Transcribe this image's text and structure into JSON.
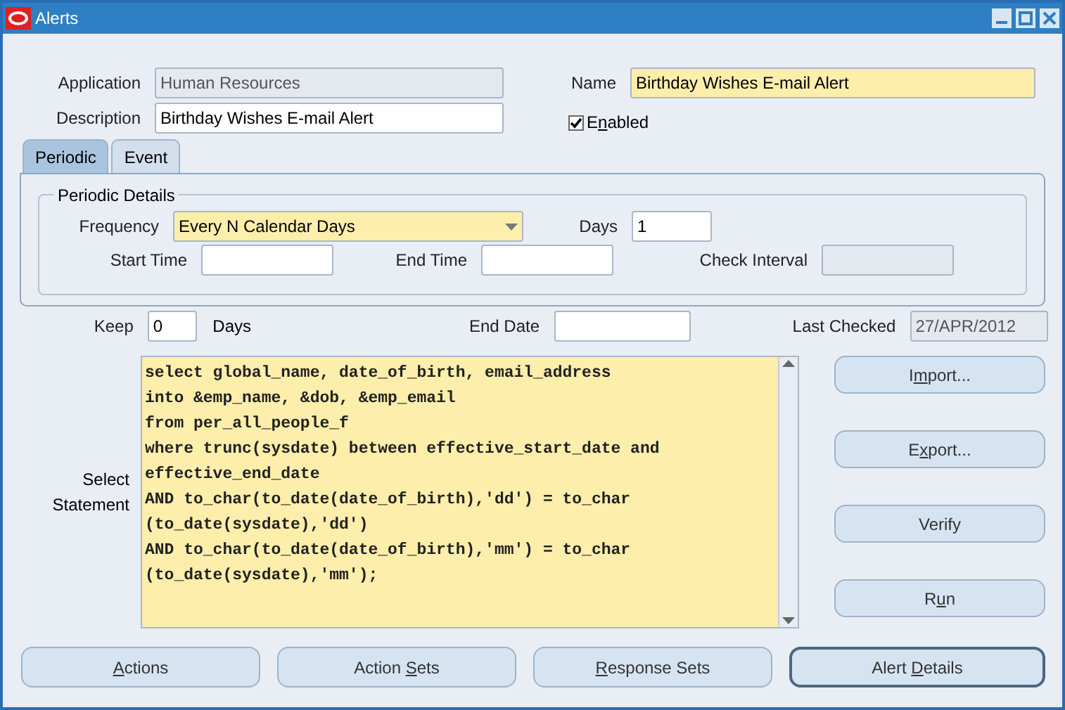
{
  "window": {
    "title": "Alerts"
  },
  "header": {
    "application": {
      "label": "Application",
      "value": "Human Resources",
      "disabled": true
    },
    "description": {
      "label": "Description",
      "value": "Birthday Wishes E-mail Alert"
    },
    "name": {
      "label": "Name",
      "value": "Birthday Wishes E-mail Alert",
      "required": true
    },
    "enabled": {
      "before": "E",
      "mnemonic": "n",
      "after": "abled",
      "checked": true
    }
  },
  "tabs": [
    {
      "label": "Periodic",
      "selected": true
    },
    {
      "label": "Event",
      "selected": false
    }
  ],
  "periodic_details": {
    "title": "Periodic Details",
    "frequency": {
      "label": "Frequency",
      "value": "Every N Calendar Days"
    },
    "days": {
      "label": "Days",
      "value": "1"
    },
    "start_time": {
      "label": "Start Time"
    },
    "end_time": {
      "label": "End Time"
    },
    "check_interval": {
      "label": "Check Interval",
      "disabled": true
    }
  },
  "keep": {
    "label": "Keep",
    "value": "0",
    "unit": "Days"
  },
  "end_date": {
    "label": "End Date"
  },
  "last_checked": {
    "label": "Last Checked",
    "value": "27/APR/2012",
    "disabled": true
  },
  "statement": {
    "label_lines": [
      "Select",
      "Statement"
    ],
    "lines": [
      "select global_name, date_of_birth, email_address",
      "into &emp_name, &dob, &emp_email",
      "from per_all_people_f",
      "where trunc(sysdate) between effective_start_date and",
      "effective_end_date",
      "AND to_char(to_date(date_of_birth),'dd') = to_char",
      "(to_date(sysdate),'dd')",
      "AND to_char(to_date(date_of_birth),'mm') = to_char",
      "(to_date(sysdate),'mm');"
    ]
  },
  "side_buttons": [
    {
      "before": "I",
      "mnemonic": "m",
      "after": "port..."
    },
    {
      "before": "E",
      "mnemonic": "x",
      "after": "port..."
    },
    {
      "before": "Verify"
    },
    {
      "before": "R",
      "mnemonic": "u",
      "after": "n"
    }
  ],
  "bottom_buttons": [
    {
      "mnemonic": "A",
      "after": "ctions",
      "selected": false
    },
    {
      "before": "Action ",
      "mnemonic": "S",
      "after": "ets",
      "selected": false
    },
    {
      "mnemonic": "R",
      "after": "esponse Sets",
      "selected": false
    },
    {
      "before": "Alert ",
      "mnemonic": "D",
      "after": "etails",
      "selected": true
    }
  ]
}
